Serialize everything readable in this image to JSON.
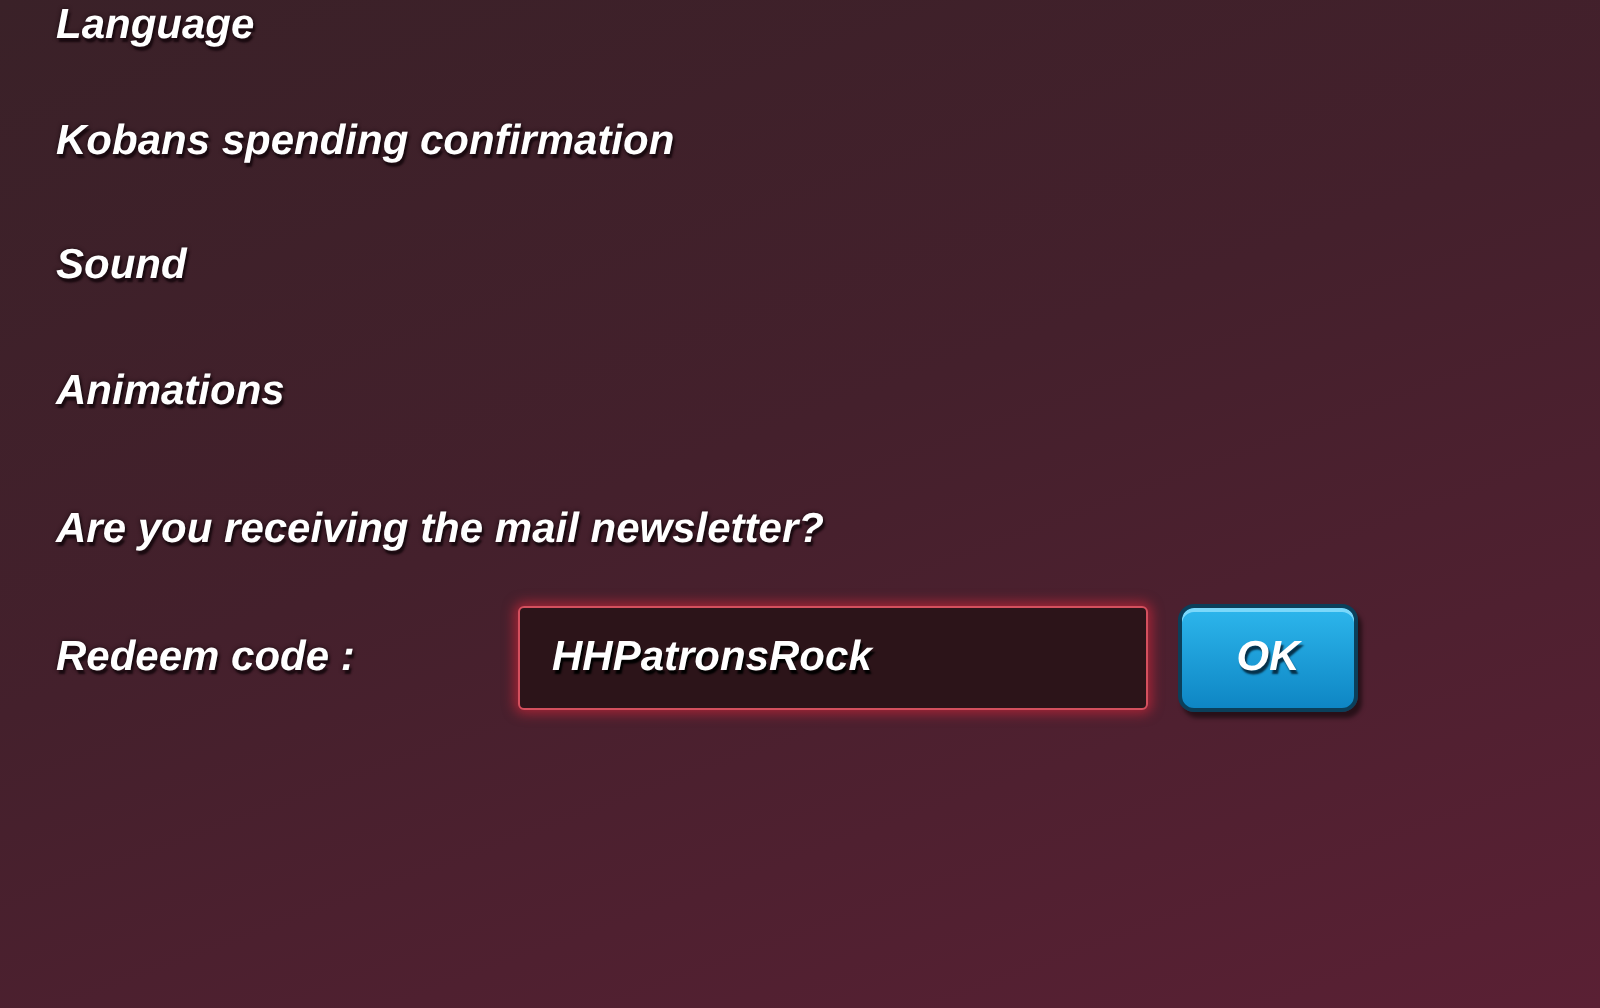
{
  "settings": [
    {
      "label": "Language"
    },
    {
      "label": "Kobans spending confirmation"
    },
    {
      "label": "Sound"
    },
    {
      "label": "Animations"
    },
    {
      "label": "Are you receiving the mail newsletter?"
    }
  ],
  "redeem": {
    "label": "Redeem code :",
    "value": "HHPatronsRock",
    "button": "OK"
  }
}
